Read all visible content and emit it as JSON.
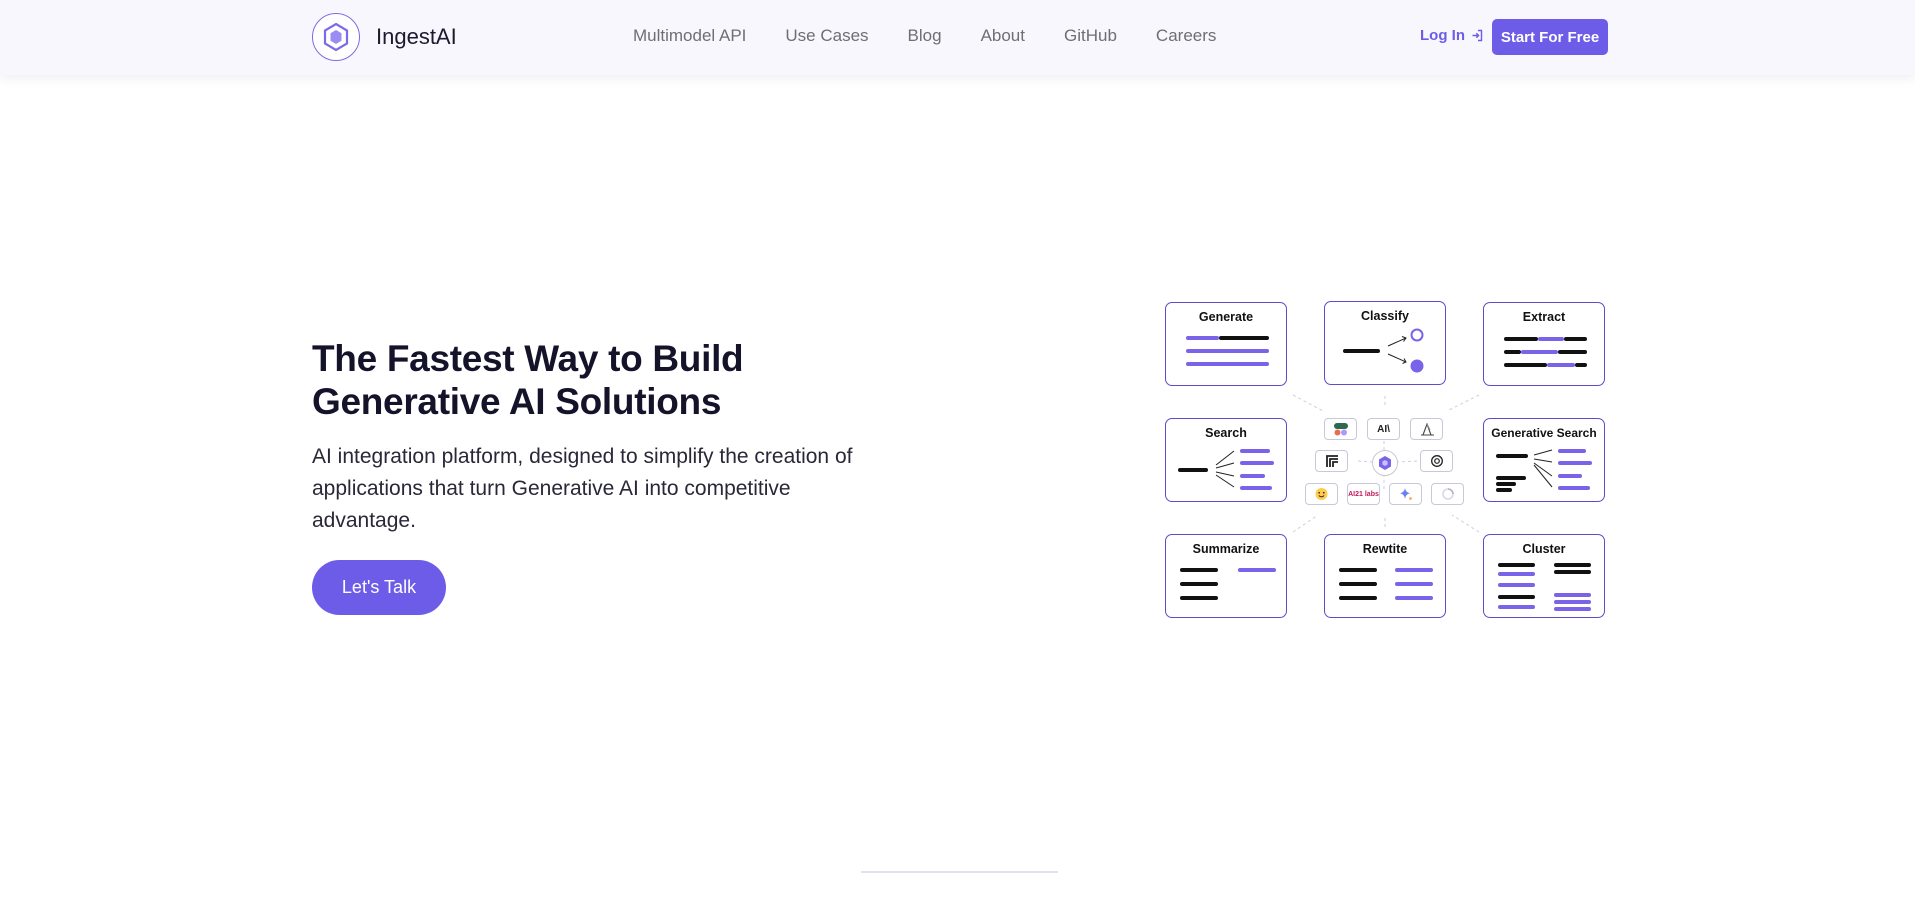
{
  "brand": {
    "name": "IngestAI"
  },
  "nav": {
    "links": [
      "Multimodel API",
      "Use Cases",
      "Blog",
      "About",
      "GitHub",
      "Careers"
    ],
    "login_label": "Log In",
    "start_label": "Start For Free"
  },
  "hero": {
    "title": "The Fastest Way to Build Generative AI Solutions",
    "subtitle": "AI integration platform, designed to simplify the creation of applications that turn Generative AI into competitive advantage.",
    "cta_label": "Let's Talk"
  },
  "diagram": {
    "cards": [
      "Generate",
      "Classify",
      "Extract",
      "Search",
      "Generative Search",
      "Summarize",
      "Rewtite",
      "Cluster"
    ],
    "hub_labels": [
      "AI\\",
      "AI21 labs"
    ]
  },
  "colors": {
    "accent": "#6c5ce7",
    "card_border": "#5b4fc7",
    "text_dark": "#15132a"
  }
}
